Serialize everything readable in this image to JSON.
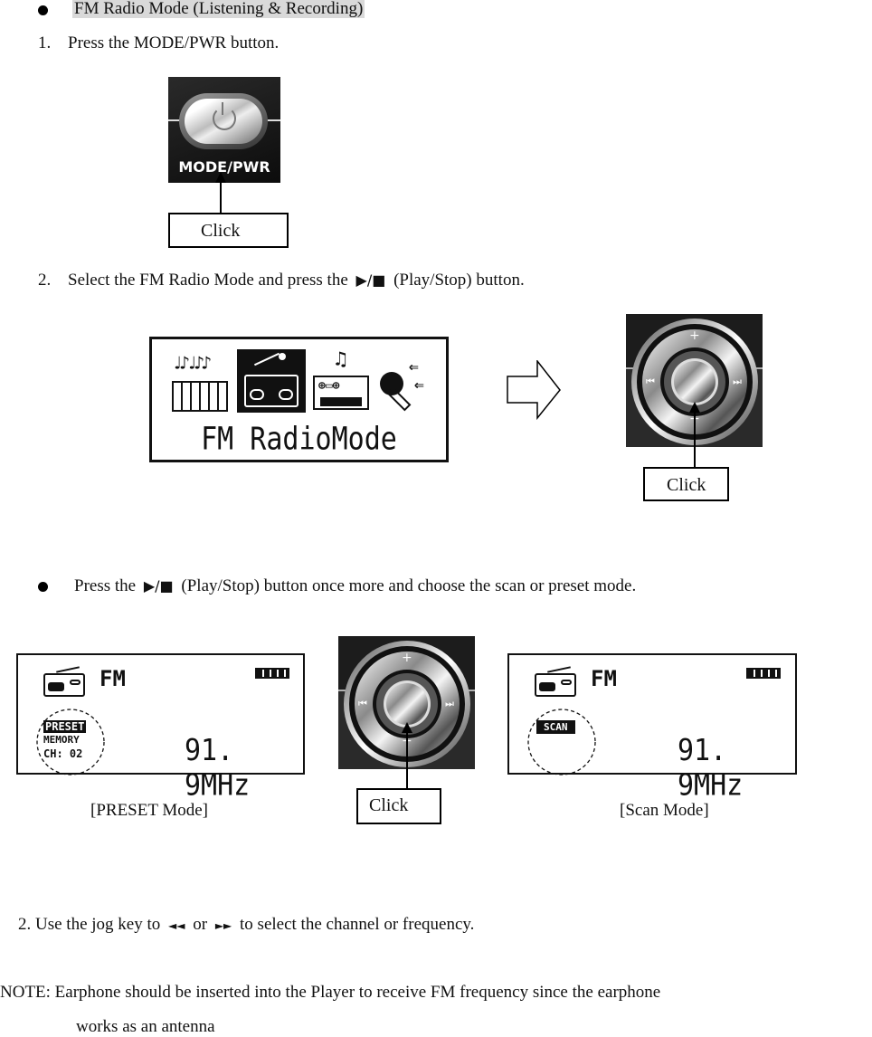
{
  "section_title": "FM Radio Mode (Listening & Recording)",
  "step1": {
    "number": "1.",
    "text": "Press the MODE/PWR button.",
    "button_label": "MODE/PWR",
    "callout": "Click"
  },
  "step2": {
    "number": "2.",
    "text_before": "Select the FM Radio Mode and press the",
    "play_stop_symbol": "▶/■",
    "text_after": "(Play/Stop) button.",
    "menu_screen_label": "FM RadioMode",
    "menu_icons": [
      "music-keyboard-icon",
      "radio-icon",
      "cassette-icon",
      "microphone-icon"
    ],
    "selected_menu_icon": "radio-icon",
    "callout": "Click"
  },
  "bullet2": {
    "text_before": "Press the",
    "play_stop_symbol": "▶/■",
    "text_after": "(Play/Stop) button once more and choose the scan or preset mode."
  },
  "preset_screen": {
    "mode": "FM",
    "badge": "PRESET",
    "line2": "MEMORY",
    "line3": "CH: 02",
    "frequency": "91. 9MHz",
    "caption": "[PRESET Mode]"
  },
  "scan_screen": {
    "mode": "FM",
    "badge": "SCAN",
    "frequency": "91. 9MHz",
    "caption": "[Scan Mode]"
  },
  "jog_callout": "Click",
  "jog_labels": {
    "up": "+",
    "down": "−",
    "left": "⏮",
    "right": "⏭"
  },
  "step3": {
    "text_before": "2. Use the jog key to",
    "rew": "◄◄",
    "mid": "or",
    "ff": "►►",
    "text_after": "to select the channel or frequency."
  },
  "note": {
    "line1": "NOTE: Earphone should be inserted into the Player to receive FM frequency since the earphone",
    "line2": "works as an antenna"
  }
}
